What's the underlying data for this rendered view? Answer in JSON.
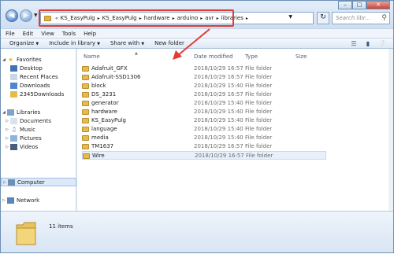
{
  "address": {
    "crumbs": [
      "KS_EasyPulg",
      "KS_EasyPulg",
      "hardware",
      "arduino",
      "avr",
      "libraries"
    ],
    "search_placeholder": "Search libr..."
  },
  "menu": [
    "File",
    "Edit",
    "View",
    "Tools",
    "Help"
  ],
  "toolbar": {
    "organize": "Organize",
    "include": "Include in library",
    "share": "Share with",
    "new_folder": "New folder"
  },
  "nav": {
    "favorites": "Favorites",
    "desktop": "Desktop",
    "recent": "Recent Places",
    "downloads": "Downloads",
    "downloads2": "2345Downloads",
    "libraries": "Libraries",
    "documents": "Documents",
    "music": "Music",
    "pictures": "Pictures",
    "videos": "Videos",
    "computer": "Computer",
    "network": "Network"
  },
  "columns": {
    "name": "Name",
    "date": "Date modified",
    "type": "Type",
    "size": "Size"
  },
  "files": [
    {
      "name": "Adafruit_GFX",
      "date": "2018/10/29 16:57",
      "type": "File folder"
    },
    {
      "name": "Adafruit-SSD1306",
      "date": "2018/10/29 16:57",
      "type": "File folder"
    },
    {
      "name": "block",
      "date": "2018/10/29 15:40",
      "type": "File folder"
    },
    {
      "name": "DS_3231",
      "date": "2018/10/29 16:57",
      "type": "File folder"
    },
    {
      "name": "generator",
      "date": "2018/10/29 15:40",
      "type": "File folder"
    },
    {
      "name": "hardware",
      "date": "2018/10/29 15:40",
      "type": "File folder"
    },
    {
      "name": "KS_EasyPulg",
      "date": "2018/10/29 15:40",
      "type": "File folder"
    },
    {
      "name": "language",
      "date": "2018/10/29 15:40",
      "type": "File folder"
    },
    {
      "name": "media",
      "date": "2018/10/29 15:40",
      "type": "File folder"
    },
    {
      "name": "TM1637",
      "date": "2018/10/29 16:57",
      "type": "File folder"
    },
    {
      "name": "Wire",
      "date": "2018/10/29 16:57",
      "type": "File folder"
    }
  ],
  "details": {
    "count": "11 items"
  },
  "colors": {
    "highlight": "#e23b33",
    "folder": "#e6bb4d"
  }
}
